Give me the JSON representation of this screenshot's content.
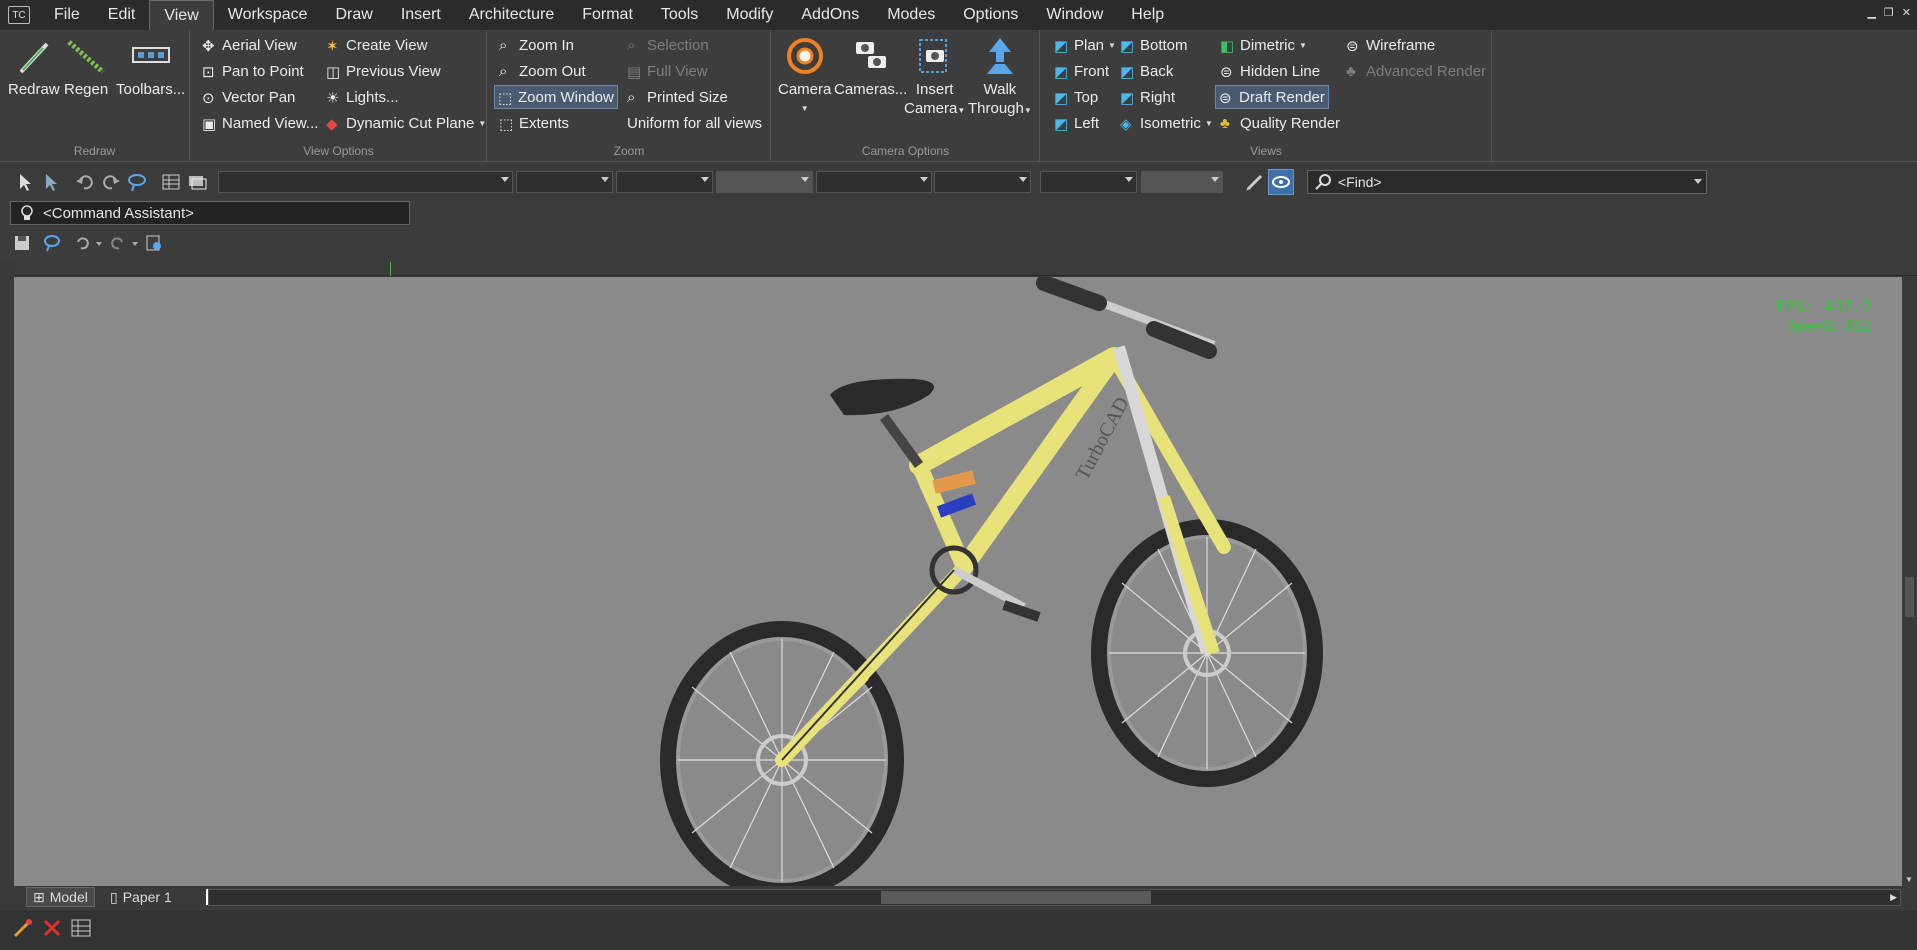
{
  "app": {
    "icon_text": "TC"
  },
  "menu": [
    "File",
    "Edit",
    "View",
    "Workspace",
    "Draw",
    "Insert",
    "Architecture",
    "Format",
    "Tools",
    "Modify",
    "AddOns",
    "Modes",
    "Options",
    "Window",
    "Help"
  ],
  "ribbon": {
    "redraw": {
      "label": "Redraw",
      "buttons": [
        "Redraw",
        "Regen",
        "Toolbars..."
      ]
    },
    "view_options": {
      "label": "View Options",
      "col1": [
        "Aerial View",
        "Pan to Point",
        "Vector Pan",
        "Named View..."
      ],
      "col2": [
        "Create View",
        "Previous View",
        "Lights...",
        "Dynamic Cut Plane"
      ]
    },
    "zoom": {
      "label": "Zoom",
      "col1": [
        "Zoom In",
        "Zoom Out",
        "Zoom Window",
        "Extents"
      ],
      "col2": [
        "Selection",
        "Full View",
        "Printed Size",
        "Uniform for all views"
      ]
    },
    "camera": {
      "label": "Camera Options",
      "buttons": [
        {
          "line1": "Camera",
          "line2": ""
        },
        {
          "line1": "Cameras...",
          "line2": ""
        },
        {
          "line1": "Insert",
          "line2": "Camera"
        },
        {
          "line1": "Walk",
          "line2": "Through"
        }
      ]
    },
    "views": {
      "label": "Views",
      "col1": [
        "Plan",
        "Front",
        "Top",
        "Left"
      ],
      "col2": [
        "Bottom",
        "Back",
        "Right",
        "Isometric"
      ],
      "col3": [
        "Dimetric",
        "Hidden Line",
        "Draft Render",
        "Quality Render"
      ],
      "col4": [
        "Wireframe",
        "Advanced Render"
      ]
    }
  },
  "toolbar": {
    "find_placeholder": "<Find>"
  },
  "command_assistant": "<Command Assistant>",
  "viewport": {
    "fps": "FPS: 437.7",
    "renderer": "OpenGL ES2",
    "model_text": "TurboCAD"
  },
  "tabs": [
    "Model",
    "Paper 1"
  ],
  "colors": {
    "bike_frame": "#e8e27a",
    "viewport_bg": "#8a8a8a",
    "fps_green": "#2fc72f"
  }
}
